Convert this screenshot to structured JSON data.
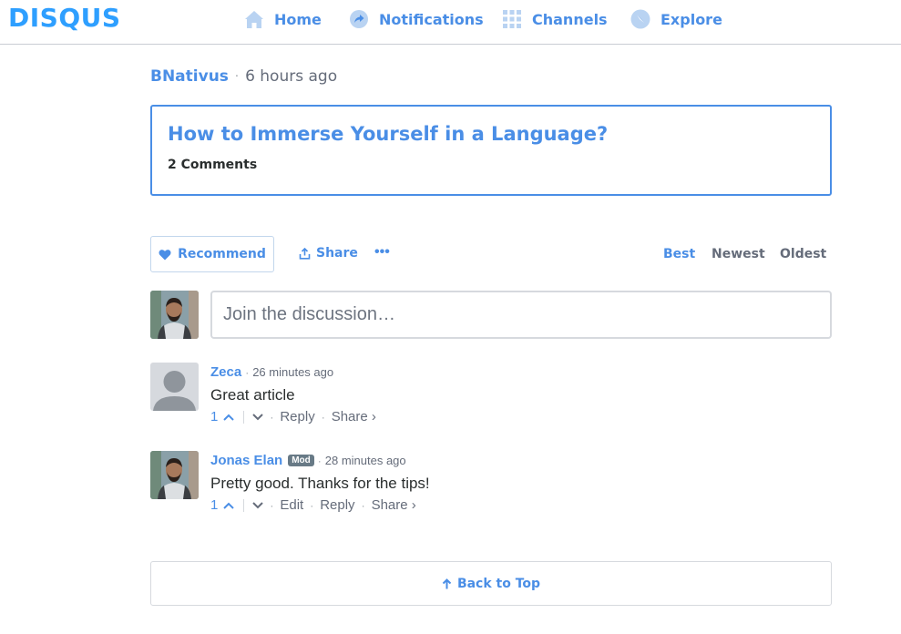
{
  "brand": {
    "logo_text": "DISQUS",
    "accent": "#4a8ee6",
    "logo_color": "#2e9fff"
  },
  "nav": {
    "items": [
      {
        "label": "Home",
        "icon": "home-icon"
      },
      {
        "label": "Notifications",
        "icon": "notifications-icon"
      },
      {
        "label": "Channels",
        "icon": "channels-grid-icon"
      },
      {
        "label": "Explore",
        "icon": "compass-icon"
      }
    ]
  },
  "post": {
    "author": "BNativus",
    "separator": "·",
    "time": "6 hours ago",
    "title": "How to Immerse Yourself in a Language?",
    "comment_count": "2 Comments"
  },
  "toolbar": {
    "recommend_label": "Recommend",
    "share_label": "Share",
    "more_label": "•••",
    "sort_options": [
      "Best",
      "Newest",
      "Oldest"
    ],
    "active_sort": "Best"
  },
  "composer": {
    "placeholder": "Join the discussion…"
  },
  "comments": [
    {
      "author": "Zeca",
      "time": "26 minutes ago",
      "body": "Great article",
      "votes": "1",
      "actions": [
        "Reply",
        "Share ›"
      ],
      "avatar": "default-avatar"
    },
    {
      "author": "Jonas Elan",
      "badge": "Mod",
      "time": "28 minutes ago",
      "body": "Pretty good. Thanks for the tips!",
      "votes": "1",
      "actions": [
        "Edit",
        "Reply",
        "Share ›"
      ],
      "avatar": "user-photo-avatar"
    }
  ],
  "footer": {
    "back_to_top_label": "Back to Top"
  }
}
